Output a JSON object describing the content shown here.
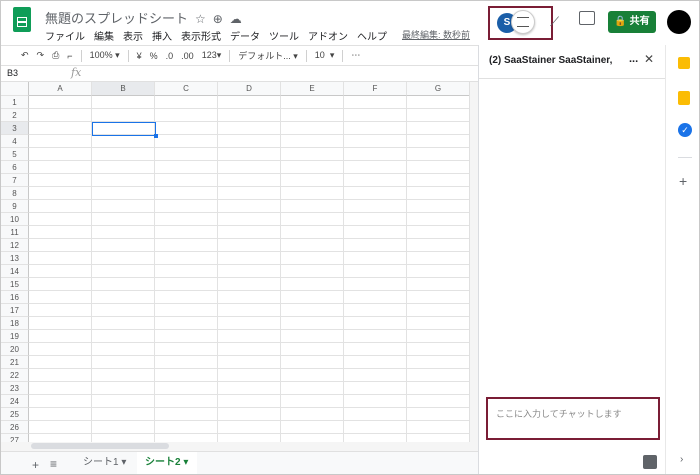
{
  "app": {
    "doc_title": "無題のスプレッドシート",
    "menu": [
      "ファイル",
      "編集",
      "表示",
      "挿入",
      "表示形式",
      "データ",
      "ツール",
      "アドオン",
      "ヘルプ"
    ],
    "last_edit": "最終編集: 数秒前",
    "share_label": "共有",
    "avatar_initial": "S"
  },
  "toolbar": {
    "zoom": "100%",
    "currency": "¥",
    "percent": "%",
    "decrease_decimal": ".0",
    "increase_decimal": ".00",
    "number_format": "123",
    "font": "デフォルト...",
    "font_size": "10",
    "more": "⋯"
  },
  "formula_bar": {
    "cell_ref": "B3",
    "fx": "fx"
  },
  "grid": {
    "columns": [
      "A",
      "B",
      "C",
      "D",
      "E",
      "F",
      "G"
    ],
    "rows": [
      "1",
      "2",
      "3",
      "4",
      "5",
      "6",
      "7",
      "8",
      "9",
      "10",
      "11",
      "12",
      "13",
      "14",
      "15",
      "16",
      "17",
      "18",
      "19",
      "20",
      "21",
      "22",
      "23",
      "24",
      "25",
      "26",
      "27"
    ],
    "selected_cell": "B3"
  },
  "sheets": {
    "tabs": [
      "シート1",
      "シート2"
    ],
    "active": "シート2"
  },
  "chat_panel": {
    "title": "(2) SaaStainer SaaStainer,",
    "more": "...",
    "close": "✕",
    "input_placeholder": "ここに入力してチャットします"
  },
  "colors": {
    "brand_green": "#0f9d58",
    "share_green": "#188038",
    "selection_blue": "#1a73e8",
    "highlight": "#7a1d35"
  }
}
